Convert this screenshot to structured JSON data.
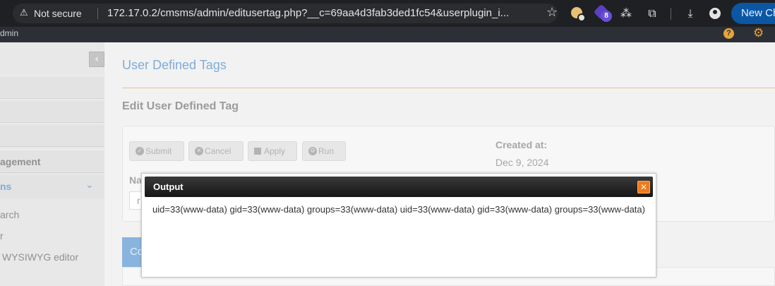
{
  "browser": {
    "security_label": "Not secure",
    "url": "172.17.0.2/cmsms/admin/editusertag.php?__c=69aa4d3fab3ded1fc54&userplugin_i...",
    "extension_badge": "8",
    "new_chrome_label": "New Ch"
  },
  "cms_header": {
    "user_fragment": "dmin"
  },
  "sidebar": {
    "items": [
      {
        "label": ""
      },
      {
        "label": ""
      },
      {
        "label": ""
      },
      {
        "label": "agement"
      }
    ],
    "active_section": "ns",
    "sub_items": [
      "arch",
      "r",
      "WYSIWYG editor"
    ]
  },
  "main": {
    "page_title": "User Defined Tags",
    "section_title": "Edit User Defined Tag",
    "buttons": {
      "submit": "Submit",
      "cancel": "Cancel",
      "apply": "Apply",
      "run": "Run"
    },
    "created_label": "Created at:",
    "created_value": "Dec 9, 2024",
    "name_label": "Na",
    "name_value": "r",
    "tab_label": "Co"
  },
  "dialog": {
    "title": "Output",
    "output": "uid=33(www-data) gid=33(www-data) groups=33(www-data) uid=33(www-data) gid=33(www-data) groups=33(www-data)"
  }
}
